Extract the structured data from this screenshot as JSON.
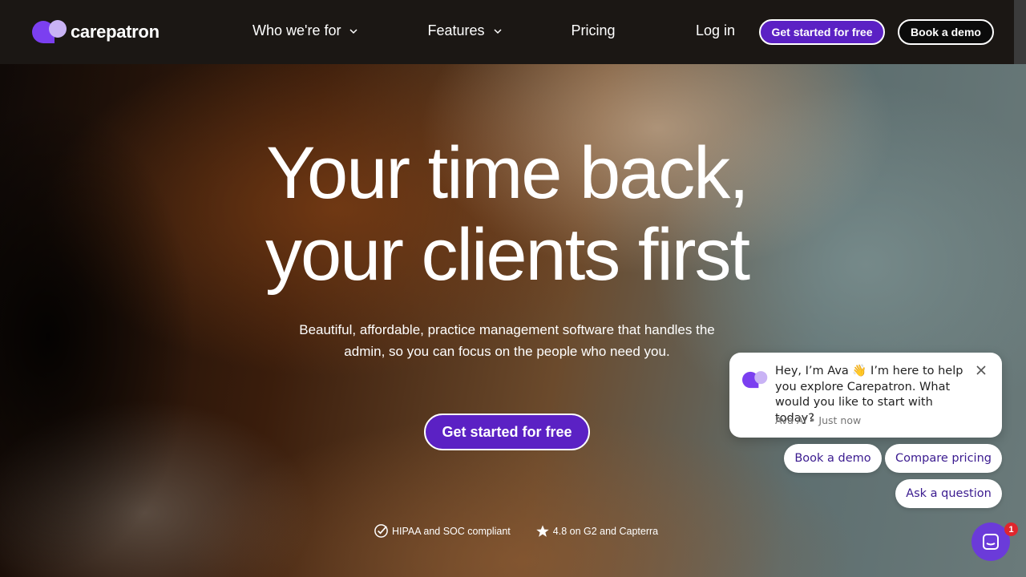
{
  "brand": {
    "name": "carepatron",
    "accent": "#5b21c4",
    "logo_light": "#c9b3f5",
    "logo_dark": "#7b3ff0"
  },
  "nav": {
    "items": [
      {
        "label": "Who we're for",
        "has_dropdown": true
      },
      {
        "label": "Features",
        "has_dropdown": true
      },
      {
        "label": "Pricing",
        "has_dropdown": false
      }
    ],
    "login_label": "Log in",
    "cta_primary": "Get started for free",
    "cta_secondary": "Book a demo"
  },
  "hero": {
    "headline_line1": "Your time back,",
    "headline_line2": "your clients first",
    "subtext_line1": "Beautiful, affordable, practice management software that handles the",
    "subtext_line2": "admin, so you can focus on the people who need you.",
    "cta": "Get started for free",
    "trust": [
      {
        "icon": "check-badge-icon",
        "text": "HIPAA and SOC compliant"
      },
      {
        "icon": "star-icon",
        "text": "4.8 on G2 and Capterra"
      }
    ]
  },
  "chat": {
    "message": "Hey, I’m Ava 👋 I’m here to help you explore Carepatron. What would you like to start with today?",
    "meta": "Ava AI • Just now",
    "quick_replies": [
      "Book a demo",
      "Compare pricing",
      "Ask a question"
    ],
    "badge_count": "1",
    "launcher_color": "#6b3bd9",
    "badge_color": "#e0262d"
  }
}
